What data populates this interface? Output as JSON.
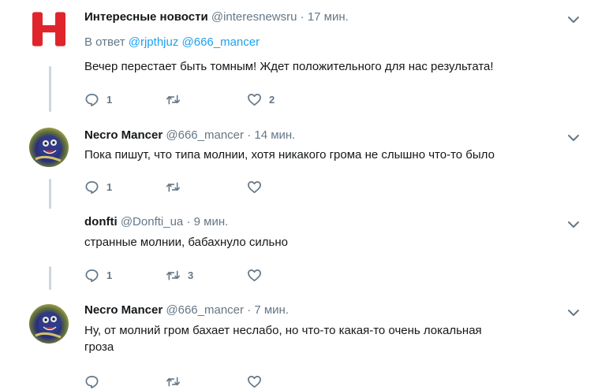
{
  "tweets": [
    {
      "name": "Интересные новости",
      "handle": "@interesnewsru",
      "time": "17 мин.",
      "reply_prefix": "В ответ",
      "reply_handles": "@rjpthjuz @666_mancer",
      "text": "Вечер перестает быть томным! Ждет положительного для нас результата!",
      "reply_count": "1",
      "retweet_count": "",
      "like_count": "2"
    },
    {
      "name": "Necro Mancer",
      "handle": "@666_mancer",
      "time": "14 мин.",
      "text": "Пока пишут, что типа молнии, хотя никакого грома не слышно что-то было",
      "reply_count": "1",
      "retweet_count": "",
      "like_count": ""
    },
    {
      "name": "donfti",
      "handle": "@Donfti_ua",
      "time": "9 мин.",
      "text": "странные молнии, бабахнуло сильно",
      "reply_count": "1",
      "retweet_count": "3",
      "like_count": ""
    },
    {
      "name": "Necro Mancer",
      "handle": "@666_mancer",
      "time": "7 мин.",
      "text_line1": "Ну, от молний гром бахает неслабо, но что-то какая-то очень локальная",
      "text_line2": "гроза",
      "reply_count": "",
      "retweet_count": "",
      "like_count": ""
    }
  ],
  "colors": {
    "accent": "#1da1f2",
    "muted": "#657786",
    "thread_line": "#ccd6dd",
    "avatar_red": "#e0242b"
  },
  "icons": {
    "reply": "reply-icon",
    "retweet": "retweet-icon",
    "like": "heart-icon",
    "more": "chevron-down-icon",
    "avatar1": "red-h-logo",
    "avatar2": "monster-avatar"
  }
}
